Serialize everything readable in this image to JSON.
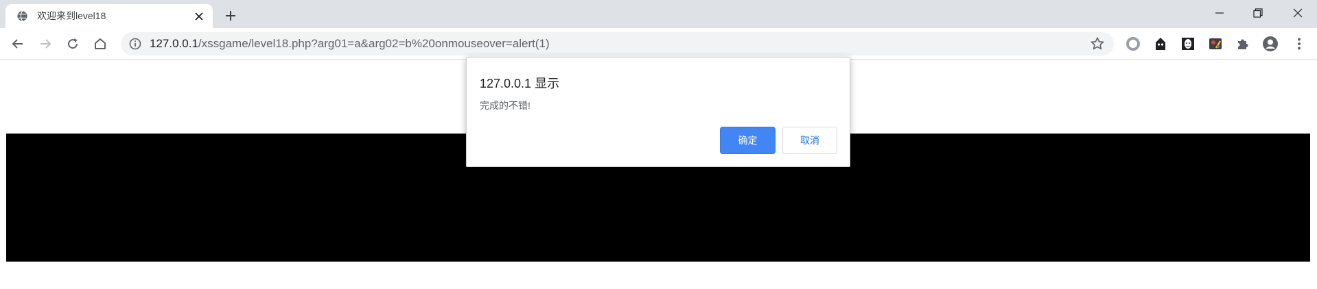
{
  "browser": {
    "tab": {
      "title": "欢迎来到level18",
      "favicon": "globe-icon"
    },
    "address_bar": {
      "url_host": "127.0.0.1",
      "url_path": "/xssgame/level18.php?arg01=a&arg02=b%20onmouseover=alert(1)"
    },
    "extensions": [
      "circle-extension-icon",
      "hacker-extension-icon",
      "mask-extension-icon",
      "tools-extension-icon",
      "puzzle-icon",
      "profile-icon"
    ]
  },
  "dialog": {
    "title": "127.0.0.1 显示",
    "message": "完成的不错!",
    "ok_label": "确定",
    "cancel_label": "取消"
  },
  "colors": {
    "primary_button": "#4285f4",
    "page_block": "#000000",
    "tabstrip": "#dee1e6"
  }
}
